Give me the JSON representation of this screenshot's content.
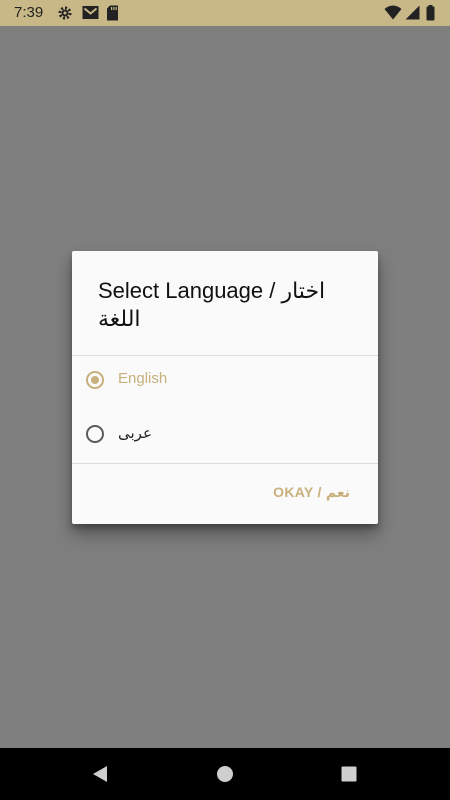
{
  "status_bar": {
    "time": "7:39",
    "icons_left": [
      "gear-icon",
      "gmail-icon",
      "sd-card-icon"
    ],
    "icons_right": [
      "wifi-icon",
      "signal-icon",
      "battery-icon"
    ],
    "color": "#c8b887"
  },
  "dialog": {
    "title": "Select Language / اختار اللغة",
    "options": [
      {
        "label": "English",
        "selected": true
      },
      {
        "label": "عربى",
        "selected": false
      }
    ],
    "okay_label": "OKAY / نعم",
    "accent_color": "#c8b07c"
  },
  "nav_bar": {
    "buttons": [
      "back-icon",
      "home-icon",
      "recents-icon"
    ]
  }
}
